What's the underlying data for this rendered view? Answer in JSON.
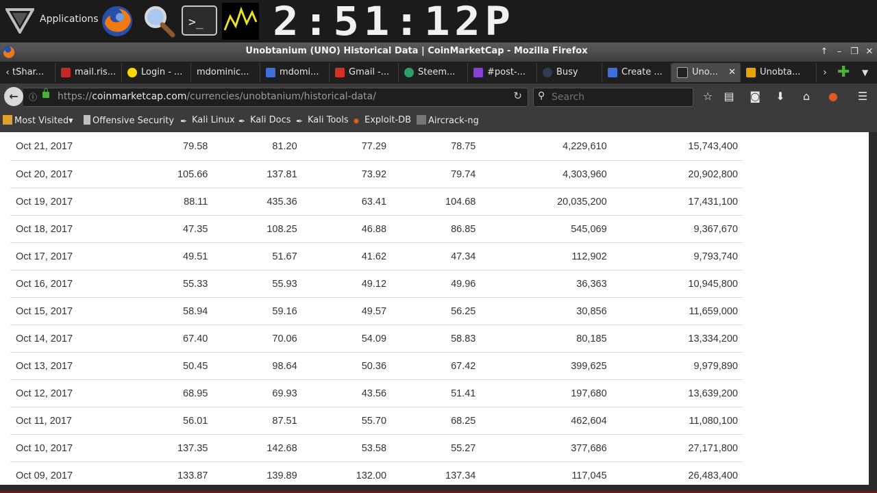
{
  "panel": {
    "applications_label": "Applications",
    "clock": "2:51:12P"
  },
  "window": {
    "title": "Unobtanium (UNO) Historical Data | CoinMarketCap - Mozilla Firefox",
    "controls": [
      "↑",
      "–",
      "❐",
      "✕"
    ]
  },
  "tabs": [
    {
      "label": "tShar...",
      "icon_color": "#2b5bd7"
    },
    {
      "label": "mail.ris...",
      "icon_color": "#c62828"
    },
    {
      "label": "Login - ...",
      "icon_color": "#ffd600"
    },
    {
      "label": "mdominic...",
      "icon_color": ""
    },
    {
      "label": "mdomi...",
      "icon_color": "#3f6fd8"
    },
    {
      "label": "Gmail -...",
      "icon_color": "#d93025"
    },
    {
      "label": "Steem...",
      "icon_color": "#2e9e6a"
    },
    {
      "label": "#post-...",
      "icon_color": "#8a3fd8"
    },
    {
      "label": "Busy",
      "icon_color": "#333a55"
    },
    {
      "label": "Create ...",
      "icon_color": "#3f6fd8"
    },
    {
      "label": "Uno...",
      "icon_color": "#222"
    },
    {
      "label": "Unobta...",
      "icon_color": "#e6a400"
    }
  ],
  "nav": {
    "url_host": "coinmarketcap.com",
    "url_prefix": "https://",
    "url_path": "/currencies/unobtanium/historical-data/",
    "search_placeholder": "Search"
  },
  "bookmarks": [
    {
      "label": "Most Visited▾",
      "icon_color": "#e0a030"
    },
    {
      "label": "Offensive Security",
      "icon_color": "#c0c0c0"
    },
    {
      "label": "Kali Linux",
      "icon_color": "#111"
    },
    {
      "label": "Kali Docs",
      "icon_color": "#111"
    },
    {
      "label": "Kali Tools",
      "icon_color": "#111"
    },
    {
      "label": "Exploit-DB",
      "icon_color": "#e06020"
    },
    {
      "label": "Aircrack-ng",
      "icon_color": "#777"
    }
  ],
  "table": {
    "rows": [
      [
        "Oct 21, 2017",
        "79.58",
        "81.20",
        "77.29",
        "78.75",
        "4,229,610",
        "15,743,400"
      ],
      [
        "Oct 20, 2017",
        "105.66",
        "137.81",
        "73.92",
        "79.74",
        "4,303,960",
        "20,902,800"
      ],
      [
        "Oct 19, 2017",
        "88.11",
        "435.36",
        "63.41",
        "104.68",
        "20,035,200",
        "17,431,100"
      ],
      [
        "Oct 18, 2017",
        "47.35",
        "108.25",
        "46.88",
        "86.85",
        "545,069",
        "9,367,670"
      ],
      [
        "Oct 17, 2017",
        "49.51",
        "51.67",
        "41.62",
        "47.34",
        "112,902",
        "9,793,740"
      ],
      [
        "Oct 16, 2017",
        "55.33",
        "55.93",
        "49.12",
        "49.96",
        "36,363",
        "10,945,800"
      ],
      [
        "Oct 15, 2017",
        "58.94",
        "59.16",
        "49.57",
        "56.25",
        "30,856",
        "11,659,000"
      ],
      [
        "Oct 14, 2017",
        "67.40",
        "70.06",
        "54.09",
        "58.83",
        "80,185",
        "13,334,200"
      ],
      [
        "Oct 13, 2017",
        "50.45",
        "98.64",
        "50.36",
        "67.42",
        "399,625",
        "9,979,890"
      ],
      [
        "Oct 12, 2017",
        "68.95",
        "69.93",
        "43.56",
        "51.41",
        "197,680",
        "13,639,200"
      ],
      [
        "Oct 11, 2017",
        "56.01",
        "87.51",
        "55.70",
        "68.25",
        "462,604",
        "11,080,100"
      ],
      [
        "Oct 10, 2017",
        "137.35",
        "142.68",
        "53.58",
        "55.27",
        "377,686",
        "27,171,800"
      ],
      [
        "Oct 09, 2017",
        "133.87",
        "139.89",
        "132.00",
        "137.34",
        "117,045",
        "26,483,400"
      ]
    ]
  }
}
